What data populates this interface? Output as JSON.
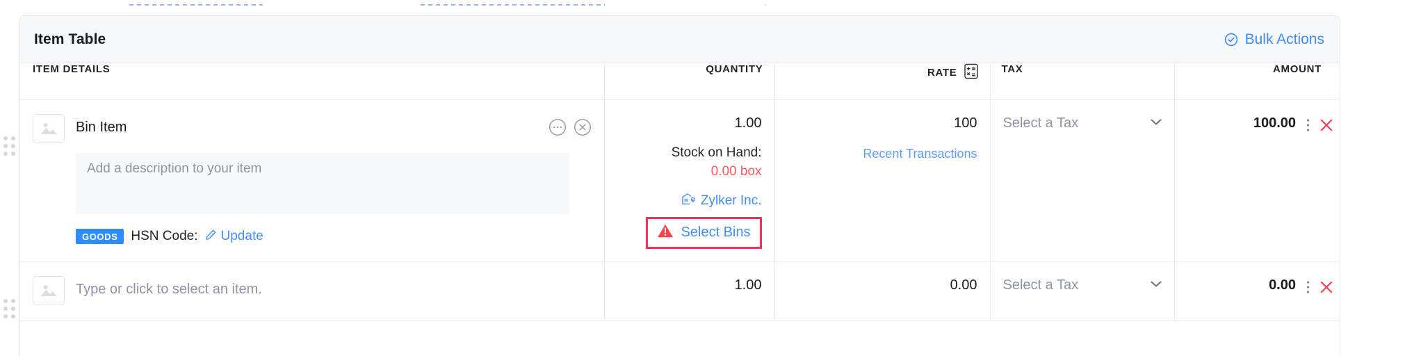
{
  "card": {
    "title": "Item Table",
    "bulk_actions_label": "Bulk Actions",
    "accent_blue": "#408dfb",
    "danger_red": "#ff5a5f",
    "highlight_border": "#f5325b"
  },
  "table": {
    "headers": {
      "item_details": "ITEM DETAILS",
      "quantity": "QUANTITY",
      "rate": "RATE",
      "tax": "TAX",
      "amount": "AMOUNT"
    },
    "rows": [
      {
        "item_name": "Bin Item",
        "description_placeholder": "Add a description to your item",
        "badge": "GOODS",
        "hsn_label": "HSN Code:",
        "hsn_action": "Update",
        "quantity": "1.00",
        "stock_label": "Stock on Hand:",
        "stock_value": "0.00 box",
        "warehouse": "Zylker Inc.",
        "bins_label": "Select Bins",
        "rate": "100",
        "recent_transactions": "Recent Transactions",
        "tax_placeholder": "Select a Tax",
        "amount": "100.00"
      },
      {
        "item_placeholder": "Type or click to select an item.",
        "quantity": "1.00",
        "rate": "0.00",
        "tax_placeholder": "Select a Tax",
        "amount": "0.00"
      }
    ]
  }
}
